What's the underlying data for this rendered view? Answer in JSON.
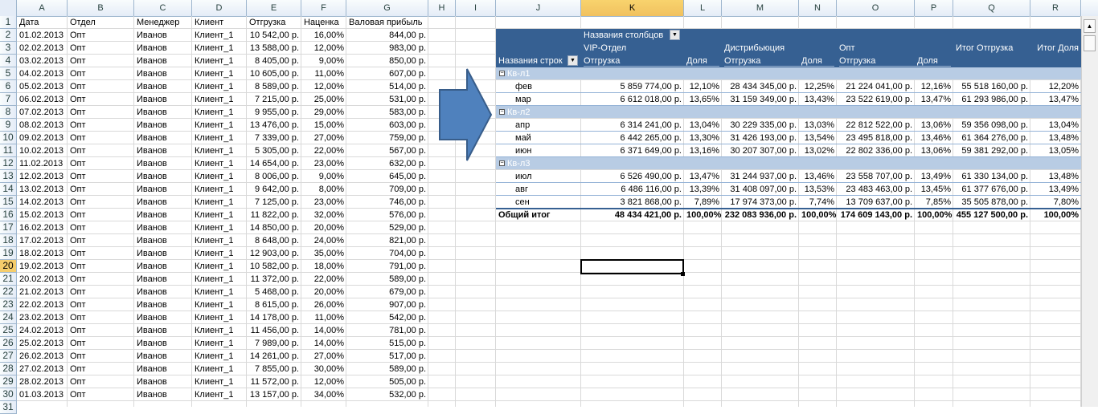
{
  "columns": [
    "A",
    "B",
    "C",
    "D",
    "E",
    "F",
    "G",
    "H",
    "I",
    "J",
    "K",
    "L",
    "M",
    "N",
    "O",
    "P",
    "Q",
    "R"
  ],
  "selected_column": "K",
  "rows": [
    "1",
    "2",
    "3",
    "4",
    "5",
    "6",
    "7",
    "8",
    "9",
    "10",
    "11",
    "12",
    "13",
    "14",
    "15",
    "16",
    "17",
    "18",
    "19",
    "20",
    "21",
    "22",
    "23",
    "24",
    "25",
    "26",
    "27",
    "28",
    "29",
    "30",
    "31"
  ],
  "selected_row": "20",
  "source_headers": [
    "Дата",
    "Отдел",
    "Менеджер",
    "Клиент",
    "Отгрузка",
    "Наценка",
    "Валовая прибыль"
  ],
  "source_rows": [
    [
      "01.02.2013",
      "Опт",
      "Иванов",
      "Клиент_1",
      "10 542,00 р.",
      "16,00%",
      "844,00 р."
    ],
    [
      "02.02.2013",
      "Опт",
      "Иванов",
      "Клиент_1",
      "13 588,00 р.",
      "12,00%",
      "983,00 р."
    ],
    [
      "03.02.2013",
      "Опт",
      "Иванов",
      "Клиент_1",
      "8 405,00 р.",
      "9,00%",
      "850,00 р."
    ],
    [
      "04.02.2013",
      "Опт",
      "Иванов",
      "Клиент_1",
      "10 605,00 р.",
      "11,00%",
      "607,00 р."
    ],
    [
      "05.02.2013",
      "Опт",
      "Иванов",
      "Клиент_1",
      "8 589,00 р.",
      "12,00%",
      "514,00 р."
    ],
    [
      "06.02.2013",
      "Опт",
      "Иванов",
      "Клиент_1",
      "7 215,00 р.",
      "25,00%",
      "531,00 р."
    ],
    [
      "07.02.2013",
      "Опт",
      "Иванов",
      "Клиент_1",
      "9 955,00 р.",
      "29,00%",
      "583,00 р."
    ],
    [
      "08.02.2013",
      "Опт",
      "Иванов",
      "Клиент_1",
      "13 476,00 р.",
      "15,00%",
      "603,00 р."
    ],
    [
      "09.02.2013",
      "Опт",
      "Иванов",
      "Клиент_1",
      "7 339,00 р.",
      "27,00%",
      "759,00 р."
    ],
    [
      "10.02.2013",
      "Опт",
      "Иванов",
      "Клиент_1",
      "5 305,00 р.",
      "22,00%",
      "567,00 р."
    ],
    [
      "11.02.2013",
      "Опт",
      "Иванов",
      "Клиент_1",
      "14 654,00 р.",
      "23,00%",
      "632,00 р."
    ],
    [
      "12.02.2013",
      "Опт",
      "Иванов",
      "Клиент_1",
      "8 006,00 р.",
      "9,00%",
      "645,00 р."
    ],
    [
      "13.02.2013",
      "Опт",
      "Иванов",
      "Клиент_1",
      "9 642,00 р.",
      "8,00%",
      "709,00 р."
    ],
    [
      "14.02.2013",
      "Опт",
      "Иванов",
      "Клиент_1",
      "7 125,00 р.",
      "23,00%",
      "746,00 р."
    ],
    [
      "15.02.2013",
      "Опт",
      "Иванов",
      "Клиент_1",
      "11 822,00 р.",
      "32,00%",
      "576,00 р."
    ],
    [
      "16.02.2013",
      "Опт",
      "Иванов",
      "Клиент_1",
      "14 850,00 р.",
      "20,00%",
      "529,00 р."
    ],
    [
      "17.02.2013",
      "Опт",
      "Иванов",
      "Клиент_1",
      "8 648,00 р.",
      "24,00%",
      "821,00 р."
    ],
    [
      "18.02.2013",
      "Опт",
      "Иванов",
      "Клиент_1",
      "12 903,00 р.",
      "35,00%",
      "704,00 р."
    ],
    [
      "19.02.2013",
      "Опт",
      "Иванов",
      "Клиент_1",
      "10 582,00 р.",
      "18,00%",
      "791,00 р."
    ],
    [
      "20.02.2013",
      "Опт",
      "Иванов",
      "Клиент_1",
      "11 372,00 р.",
      "22,00%",
      "589,00 р."
    ],
    [
      "21.02.2013",
      "Опт",
      "Иванов",
      "Клиент_1",
      "5 468,00 р.",
      "20,00%",
      "679,00 р."
    ],
    [
      "22.02.2013",
      "Опт",
      "Иванов",
      "Клиент_1",
      "8 615,00 р.",
      "26,00%",
      "907,00 р."
    ],
    [
      "23.02.2013",
      "Опт",
      "Иванов",
      "Клиент_1",
      "14 178,00 р.",
      "11,00%",
      "542,00 р."
    ],
    [
      "24.02.2013",
      "Опт",
      "Иванов",
      "Клиент_1",
      "11 456,00 р.",
      "14,00%",
      "781,00 р."
    ],
    [
      "25.02.2013",
      "Опт",
      "Иванов",
      "Клиент_1",
      "7 989,00 р.",
      "14,00%",
      "515,00 р."
    ],
    [
      "26.02.2013",
      "Опт",
      "Иванов",
      "Клиент_1",
      "14 261,00 р.",
      "27,00%",
      "517,00 р."
    ],
    [
      "27.02.2013",
      "Опт",
      "Иванов",
      "Клиент_1",
      "7 855,00 р.",
      "30,00%",
      "589,00 р."
    ],
    [
      "28.02.2013",
      "Опт",
      "Иванов",
      "Клиент_1",
      "11 572,00 р.",
      "12,00%",
      "505,00 р."
    ],
    [
      "01.03.2013",
      "Опт",
      "Иванов",
      "Клиент_1",
      "13 157,00 р.",
      "34,00%",
      "532,00 р."
    ]
  ],
  "pivot": {
    "col_labels_caption": "Названия столбцов",
    "row_labels_caption": "Названия строк",
    "depts": [
      "VIP-Отдел",
      "Дистрибьюция",
      "Опт"
    ],
    "total_shipment_header": "Итог  Отгрузка",
    "total_share_header": "Итог Доля",
    "measure_shipment": "Отгрузка",
    "measure_share": "Доля",
    "groups": [
      {
        "name": "Кв-л1",
        "rows": [
          {
            "label": "фев",
            "v": [
              "5 859 774,00 р.",
              "12,10%",
              "28 434 345,00 р.",
              "12,25%",
              "21 224 041,00 р.",
              "12,16%",
              "55 518 160,00 р.",
              "12,20%"
            ]
          },
          {
            "label": "мар",
            "v": [
              "6 612 018,00 р.",
              "13,65%",
              "31 159 349,00 р.",
              "13,43%",
              "23 522 619,00 р.",
              "13,47%",
              "61 293 986,00 р.",
              "13,47%"
            ]
          }
        ]
      },
      {
        "name": "Кв-л2",
        "rows": [
          {
            "label": "апр",
            "v": [
              "6 314 241,00 р.",
              "13,04%",
              "30 229 335,00 р.",
              "13,03%",
              "22 812 522,00 р.",
              "13,06%",
              "59 356 098,00 р.",
              "13,04%"
            ]
          },
          {
            "label": "май",
            "v": [
              "6 442 265,00 р.",
              "13,30%",
              "31 426 193,00 р.",
              "13,54%",
              "23 495 818,00 р.",
              "13,46%",
              "61 364 276,00 р.",
              "13,48%"
            ]
          },
          {
            "label": "июн",
            "v": [
              "6 371 649,00 р.",
              "13,16%",
              "30 207 307,00 р.",
              "13,02%",
              "22 802 336,00 р.",
              "13,06%",
              "59 381 292,00 р.",
              "13,05%"
            ]
          }
        ]
      },
      {
        "name": "Кв-л3",
        "rows": [
          {
            "label": "июл",
            "v": [
              "6 526 490,00 р.",
              "13,47%",
              "31 244 937,00 р.",
              "13,46%",
              "23 558 707,00 р.",
              "13,49%",
              "61 330 134,00 р.",
              "13,48%"
            ]
          },
          {
            "label": "авг",
            "v": [
              "6 486 116,00 р.",
              "13,39%",
              "31 408 097,00 р.",
              "13,53%",
              "23 483 463,00 р.",
              "13,45%",
              "61 377 676,00 р.",
              "13,49%"
            ]
          },
          {
            "label": "сен",
            "v": [
              "3 821 868,00 р.",
              "7,89%",
              "17 974 373,00 р.",
              "7,74%",
              "13 709 637,00 р.",
              "7,85%",
              "35 505 878,00 р.",
              "7,80%"
            ]
          }
        ]
      }
    ],
    "grand_total_label": "Общий итог",
    "grand_total": [
      "48 434 421,00 р.",
      "100,00%",
      "232 083 936,00 р.",
      "100,00%",
      "174 609 143,00 р.",
      "100,00%",
      "455 127 500,00 р.",
      "100,00%"
    ]
  },
  "colors": {
    "pivot_header": "#366092",
    "pivot_band": "#b8cce4",
    "arrow": "#4f81bd"
  },
  "icons": {
    "dropdown": "dropdown-arrow-icon",
    "collapse": "collapse-minus-icon",
    "arrow": "right-arrow-shape",
    "scroll_up": "scroll-up-icon"
  }
}
